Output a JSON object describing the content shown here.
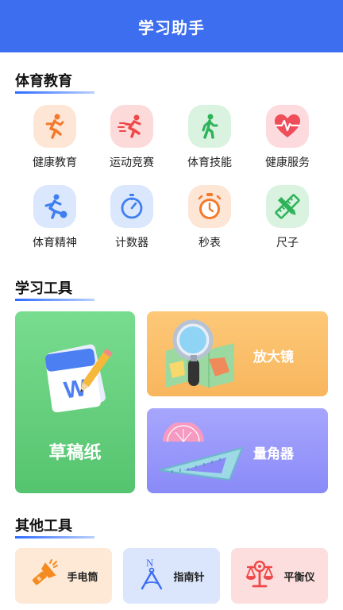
{
  "header": {
    "title": "学习助手"
  },
  "sections": {
    "sports": "体育教育",
    "study": "学习工具",
    "other": "其他工具"
  },
  "sports_items": [
    {
      "label": "健康教育",
      "icon": "runner-icon",
      "color": "#f37a2c",
      "bg": "#fde6d5"
    },
    {
      "label": "运动竞赛",
      "icon": "sprinter-icon",
      "color": "#ef4848",
      "bg": "#fddada"
    },
    {
      "label": "体育技能",
      "icon": "walker-icon",
      "color": "#2fb35a",
      "bg": "#d9f3e0"
    },
    {
      "label": "健康服务",
      "icon": "heartbeat-icon",
      "color": "#ef4d5a",
      "bg": "#fddade"
    },
    {
      "label": "体育精神",
      "icon": "soccer-player-icon",
      "color": "#3f7ff0",
      "bg": "#dbe7fd"
    },
    {
      "label": "计数器",
      "icon": "stopwatch-icon",
      "color": "#3f7ff0",
      "bg": "#dbe7fd"
    },
    {
      "label": "秒表",
      "icon": "timer-icon",
      "color": "#f37a2c",
      "bg": "#fde6d5"
    },
    {
      "label": "尺子",
      "icon": "ruler-pencil-icon",
      "color": "#2fb35a",
      "bg": "#d9f3e0"
    }
  ],
  "study_tools": {
    "draft": {
      "label": "草稿纸",
      "icon": "notebook-pencil-icon",
      "color": "#5ecf7c"
    },
    "magnifier": {
      "label": "放大镜",
      "icon": "magnifier-map-icon",
      "color": "#fcc06e"
    },
    "protractor": {
      "label": "量角器",
      "icon": "protractor-icon",
      "color": "#9d9cfb"
    }
  },
  "other_tools": [
    {
      "label": "手电筒",
      "icon": "flashlight-icon",
      "bg": "#fde9d6",
      "color": "#f58a1f"
    },
    {
      "label": "指南针",
      "icon": "compass-icon",
      "bg": "#dbe6fd",
      "color": "#3d6ef0"
    },
    {
      "label": "平衡仪",
      "icon": "balance-scale-icon",
      "bg": "#fddede",
      "color": "#ef4848"
    }
  ]
}
